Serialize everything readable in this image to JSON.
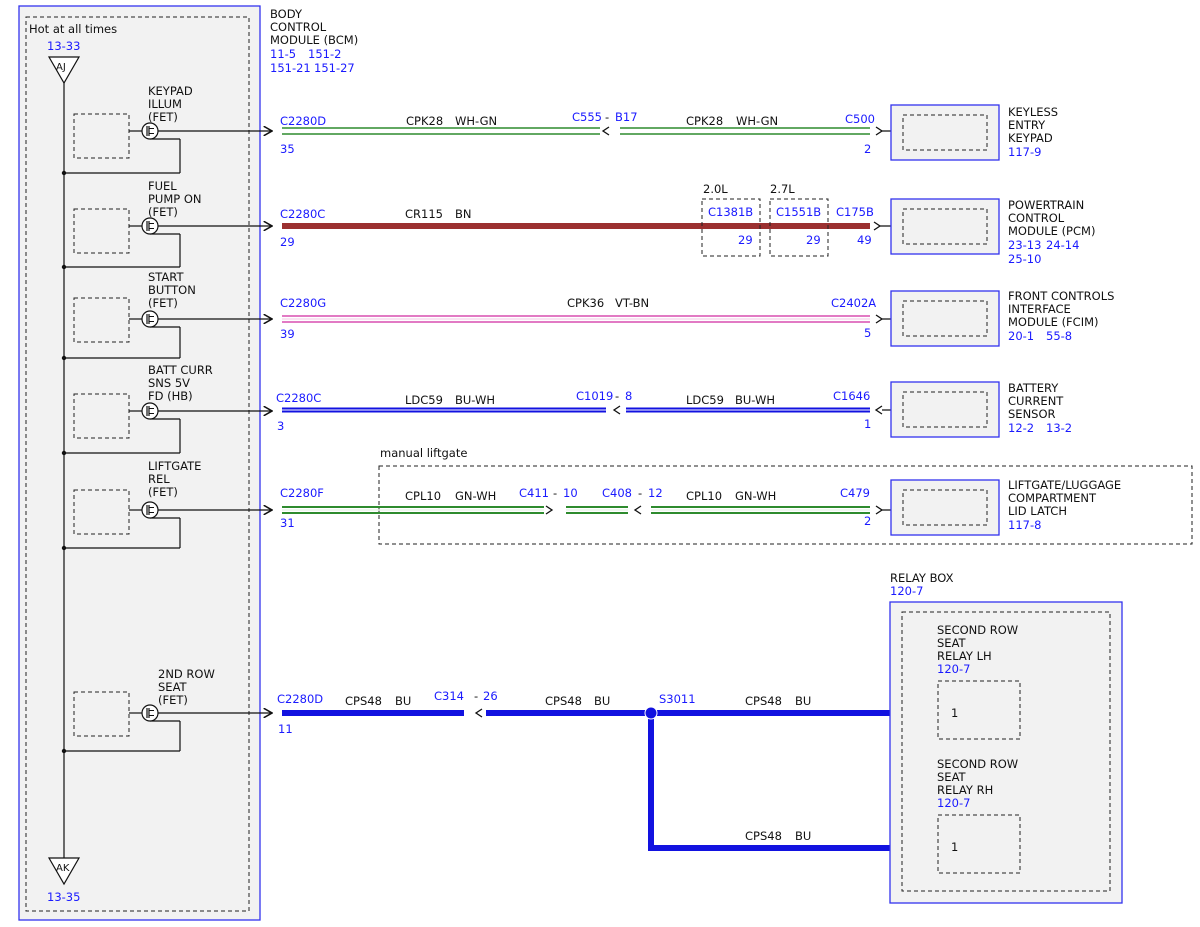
{
  "bcm": {
    "hot_label": "Hot at all times",
    "top_ref": "13-33",
    "top_tag": "AJ",
    "bottom_tag": "AK",
    "bottom_ref": "13-35",
    "title_lines": [
      "BODY",
      "CONTROL",
      "MODULE (BCM)"
    ],
    "refs_line1": [
      "11-5",
      "151-2"
    ],
    "refs_line2": [
      "151-21",
      "151-27"
    ]
  },
  "fets": [
    {
      "label_lines": [
        "KEYPAD",
        "ILLUM",
        "(FET)"
      ]
    },
    {
      "label_lines": [
        "FUEL",
        "PUMP ON",
        "(FET)"
      ]
    },
    {
      "label_lines": [
        "START",
        "BUTTON",
        "(FET)"
      ]
    },
    {
      "label_lines": [
        "BATT CURR",
        "SNS 5V",
        "FD (HB)"
      ]
    },
    {
      "label_lines": [
        "LIFTGATE",
        "REL",
        "(FET)"
      ]
    },
    {
      "label_lines": [
        "2ND ROW",
        "SEAT",
        "(FET)"
      ]
    }
  ],
  "circuits": {
    "keypad": {
      "conn_left": "C2280D",
      "pin_left": "35",
      "wire1": "CPK28",
      "color1": "WH-GN",
      "inline_a": "C555",
      "inline_dash": "-",
      "inline_b": "B17",
      "wire2": "CPK28",
      "color2": "WH-GN",
      "conn_right": "C500",
      "pin_right": "2"
    },
    "pcm": {
      "conn_left": "C2280C",
      "pin_left": "29",
      "wire": "CR115",
      "color": "BN",
      "variant_a": "2.0L",
      "variant_a_conn": "C1381B",
      "variant_a_pin": "29",
      "variant_b": "2.7L",
      "variant_b_conn": "C1551B",
      "variant_b_pin": "29",
      "conn_right": "C175B",
      "pin_right": "49"
    },
    "fcim": {
      "conn_left": "C2280G",
      "pin_left": "39",
      "wire": "CPK36",
      "color": "VT-BN",
      "conn_right": "C2402A",
      "pin_right": "5"
    },
    "battery": {
      "conn_left": "C2280C",
      "pin_left": "3",
      "wire1": "LDC59",
      "color1": "BU-WH",
      "inline_a": "C1019",
      "inline_dash": "-",
      "inline_b": "8",
      "wire2": "LDC59",
      "color2": "BU-WH",
      "conn_right": "C1646",
      "pin_right": "1"
    },
    "liftgate": {
      "option_label": "manual liftgate",
      "conn_left": "C2280F",
      "pin_left": "31",
      "wire1": "CPL10",
      "color1": "GN-WH",
      "inline1_a": "C411",
      "inline1_dash": "-",
      "inline1_b": "10",
      "inline2_a": "C408",
      "inline2_dash": "-",
      "inline2_b": "12",
      "wire2": "CPL10",
      "color2": "GN-WH",
      "conn_right": "C479",
      "pin_right": "2"
    },
    "seat": {
      "conn_left": "C2280D",
      "pin_left": "11",
      "wire1": "CPS48",
      "color1": "BU",
      "inline_a": "C314",
      "inline_dash": "-",
      "inline_b": "26",
      "wire2": "CPS48",
      "color2": "BU",
      "splice": "S3011",
      "wire3": "CPS48",
      "color3": "BU",
      "wire4": "CPS48",
      "color4": "BU"
    }
  },
  "components": {
    "keypad": {
      "lines": [
        "KEYLESS",
        "ENTRY",
        "KEYPAD"
      ],
      "refs": [
        "117-9"
      ]
    },
    "pcm": {
      "lines": [
        "POWERTRAIN",
        "CONTROL",
        "MODULE (PCM)"
      ],
      "refs_line1": [
        "23-13",
        "24-14"
      ],
      "refs_line2": [
        "25-10"
      ]
    },
    "fcim": {
      "lines": [
        "FRONT CONTROLS",
        "INTERFACE",
        "MODULE (FCIM)"
      ],
      "refs": [
        "20-1",
        "55-8"
      ]
    },
    "battery": {
      "lines": [
        "BATTERY",
        "CURRENT",
        "SENSOR"
      ],
      "refs": [
        "12-2",
        "13-2"
      ]
    },
    "liftgate": {
      "lines": [
        "LIFTGATE/LUGGAGE",
        "COMPARTMENT",
        "LID LATCH"
      ],
      "refs": [
        "117-8"
      ]
    }
  },
  "relay_box": {
    "title": "RELAY BOX",
    "ref": "120-7",
    "relay_lh": {
      "lines": [
        "SECOND ROW",
        "SEAT",
        "RELAY LH"
      ],
      "ref": "120-7",
      "pin": "1"
    },
    "relay_rh": {
      "lines": [
        "SECOND ROW",
        "SEAT",
        "RELAY RH"
      ],
      "ref": "120-7",
      "pin": "1"
    }
  },
  "colors": {
    "brown": "#9b3030",
    "blue": "#1212e0",
    "green": "#2e8b2e",
    "green_white": "#e8f5e8",
    "pink": "#d94fb0",
    "pink_white": "#f7d8ee",
    "ref_blue": "#1a1aff"
  }
}
